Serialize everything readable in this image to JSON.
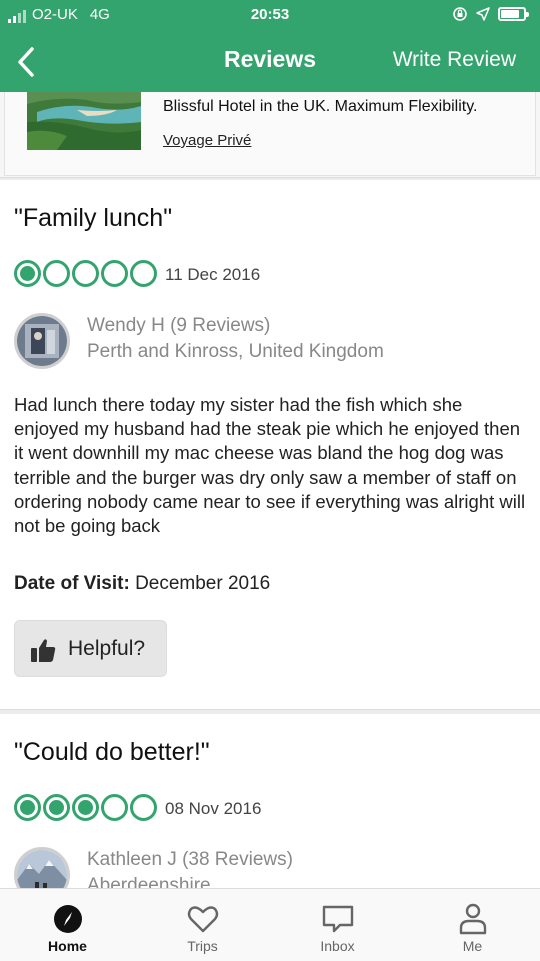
{
  "status_bar": {
    "carrier": "O2-UK",
    "network": "4G",
    "time": "20:53"
  },
  "header": {
    "title": "Reviews",
    "write_review": "Write Review"
  },
  "ad": {
    "text": "Blissful Hotel in the UK. Maximum Flexibility.",
    "sponsor": "Voyage Privé"
  },
  "reviews": [
    {
      "title": "\"Family lunch\"",
      "rating": 1,
      "rating_max": 5,
      "date": "11 Dec 2016",
      "reviewer": "Wendy H (9 Reviews)",
      "location": "Perth and Kinross, United Kingdom",
      "body": "Had lunch there today my sister had the fish which she enjoyed my husband had the steak pie which he enjoyed then it went downhill my mac cheese was bland the hog dog was terrible and the burger was dry only saw a member of staff on ordering nobody came near to see if everything was alright will not be going back",
      "visit_label": "Date of Visit:",
      "visit_value": "December 2016",
      "helpful_label": "Helpful?"
    },
    {
      "title": "\"Could do better!\"",
      "rating": 3,
      "rating_max": 5,
      "date": "08 Nov 2016",
      "reviewer": "Kathleen J (38 Reviews)",
      "location": "Aberdeenshire"
    }
  ],
  "tabs": [
    {
      "label": "Home",
      "icon": "compass-icon",
      "active": true
    },
    {
      "label": "Trips",
      "icon": "heart-icon",
      "active": false
    },
    {
      "label": "Inbox",
      "icon": "message-icon",
      "active": false
    },
    {
      "label": "Me",
      "icon": "person-icon",
      "active": false
    }
  ],
  "colors": {
    "brand": "#34a46e",
    "header_text": "#ffffff"
  }
}
